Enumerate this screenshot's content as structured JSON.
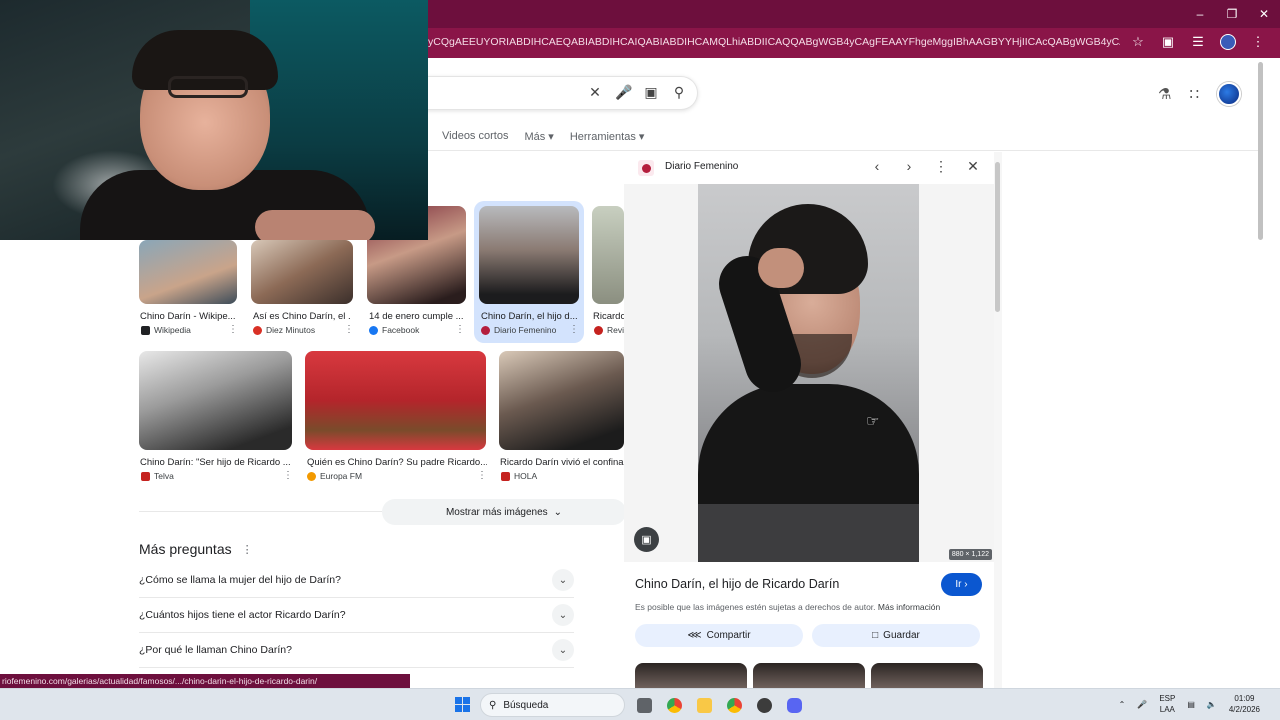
{
  "browser": {
    "url": "yCQgAEEUYORIABDIHCAEQABIABDIHCAIQABIABDIHCAMQLhiABDIICAQQABgWGB4yCAgFEAAYFhgeMggIBhAAGBYYHjIICAcQABgWGB4yCAgIEAAYFhgeMggICRAAGB...",
    "status_url": "riofemenino.com/galerias/actualidad/famosos/.../chino-darin-el-hijo-de-ricardo-darin/"
  },
  "tabs": [
    "Videos cortos",
    "Más",
    "Herramientas"
  ],
  "images_row1": [
    {
      "caption": "Chino Darín - Wikipe...",
      "source": "Wikipedia",
      "source_color": "#202124"
    },
    {
      "caption": "Así es Chino Darín, el ...",
      "source": "Diez Minutos",
      "source_color": "#d93025"
    },
    {
      "caption": "14 de enero cumple ...",
      "source": "Facebook",
      "source_color": "#1877f2"
    },
    {
      "caption": "Chino Darín, el hijo d...",
      "source": "Diario Femenino",
      "source_color": "#b41e3d"
    },
    {
      "caption": "Ricardo",
      "source": "Revi",
      "source_color": "#c5221f"
    }
  ],
  "images_row2": [
    {
      "caption": "Chino Darín: \"Ser hijo de Ricardo ...",
      "source": "Telva",
      "source_color": "#c5221f"
    },
    {
      "caption": "Quién es Chino Darín? Su padre Ricardo...",
      "source": "Europa FM",
      "source_color": "#f29900"
    },
    {
      "caption": "Ricardo Darín vivió el confinam",
      "source": "HOLA",
      "source_color": "#c5221f"
    }
  ],
  "more_images_label": "Mostrar más imágenes",
  "section_title": "Más preguntas",
  "faqs": [
    "¿Cómo se llama la mujer del hijo de Darín?",
    "¿Cuántos hijos tiene el actor Ricardo Darín?",
    "¿Por qué le llaman Chino Darín?"
  ],
  "panel": {
    "source": "Diario Femenino",
    "title": "Chino Darín, el hijo de Ricardo Darín",
    "go_label": "Ir",
    "dimensions": "880 × 1,122",
    "copyright_text": "Es posible que las imágenes estén sujetas a derechos de autor.",
    "more_info": "Más información",
    "share_label": "Compartir",
    "save_label": "Guardar"
  },
  "taskbar": {
    "search_label": "Búsqueda",
    "lang_top": "ESP",
    "lang_bottom": "LAA",
    "time": "01:09",
    "date": "4/2/2026"
  },
  "colors": {
    "titlebar": "#6d0f3d",
    "urlbar": "#8a1548",
    "accent": "#0b57d0",
    "selected": "#d3e3fd"
  }
}
